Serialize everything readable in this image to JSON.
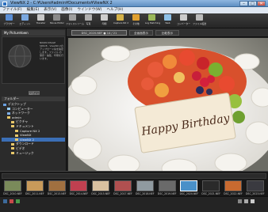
{
  "window": {
    "title": "ViewNX 2 - C:¥Users¥admin¥Documents¥ViewNX 2",
    "min_label": "–",
    "max_label": "□",
    "close_label": "✕"
  },
  "menu": [
    "ファイル(F)",
    "編集(E)",
    "表示(V)",
    "画像(I)",
    "ウインドウ(W)",
    "ヘルプ(H)"
  ],
  "toolbar": [
    {
      "label": "ブラウザー",
      "icon": "browser-icon",
      "color": "#5b8fd6"
    },
    {
      "label": "エディット",
      "icon": "edit-icon",
      "color": "#7aa8e0"
    },
    {
      "label": "Transfer",
      "icon": "transfer-icon",
      "color": "#c9c9c9"
    },
    {
      "label": "Movie Editor",
      "icon": "movie-editor-icon",
      "color": "#8a8a8a"
    },
    {
      "label": "フォトストリーム",
      "icon": "photostream-icon",
      "color": "#9f9f9f"
    },
    {
      "label": "写真",
      "icon": "photo-icon",
      "color": "#b0b0b0"
    },
    {
      "label": "印刷",
      "icon": "print-icon",
      "color": "#cfcfcf"
    },
    {
      "label": "Capture NX 2",
      "icon": "capture-nx-icon",
      "color": "#d4b24a"
    },
    {
      "label": "その他",
      "icon": "other-icon",
      "color": "#e0a030"
    },
    {
      "label": "Log Matching",
      "icon": "log-matching-icon",
      "color": "#9ab85a"
    },
    {
      "label": "Web",
      "icon": "web-icon",
      "color": "#8ec1e8"
    },
    {
      "label": "コンバーター",
      "icon": "converter-icon",
      "color": "#cccccc"
    },
    {
      "label": "ファイル転送",
      "icon": "file-transfer-icon",
      "color": "#bbbbbb"
    }
  ],
  "left_panel": {
    "tab_title": "My Picturetown",
    "info_text": "NIKON IMAGE SPACE、ViewNX 2のアップロード先を指定します。ファイル の保存・編集、印刷を行います。",
    "button_label": "ログイン",
    "tree_title": "フォルダー",
    "tree": [
      {
        "label": "デスクトップ",
        "color": "#6aa0e0",
        "indent": 0,
        "selected": false
      },
      {
        "label": "コンピューター",
        "color": "#9ad0ff",
        "indent": 1,
        "selected": false
      },
      {
        "label": "ネットワーク",
        "color": "#7fb0e8",
        "indent": 1,
        "selected": false
      },
      {
        "label": "admin",
        "color": "#e8c86a",
        "indent": 1,
        "selected": false
      },
      {
        "label": "ピクチャ",
        "color": "#e8c86a",
        "indent": 2,
        "selected": false
      },
      {
        "label": "ドキュメント",
        "color": "#e8c86a",
        "indent": 2,
        "selected": false
      },
      {
        "label": "Capture NX 2",
        "color": "#e8c86a",
        "indent": 3,
        "selected": false
      },
      {
        "label": "ViewNX",
        "color": "#e8c86a",
        "indent": 3,
        "selected": false
      },
      {
        "label": "ViewNX 2",
        "color": "#e8c86a",
        "indent": 3,
        "selected": true
      },
      {
        "label": "ダウンロード",
        "color": "#e8c86a",
        "indent": 2,
        "selected": false
      },
      {
        "label": "ビデオ",
        "color": "#e8c86a",
        "indent": 2,
        "selected": false
      },
      {
        "label": "ミュージック",
        "color": "#e8c86a",
        "indent": 2,
        "selected": false
      }
    ]
  },
  "view_tabs": [
    {
      "label": "DSC_2020.NEF ● 14 / 21",
      "active": true
    },
    {
      "label": "全画面表示",
      "active": false
    },
    {
      "label": "比較表示",
      "active": false
    }
  ],
  "cake": {
    "plaque_text": "Happy Birthday",
    "plaque_color": "#f4ead6",
    "text_color": "#4a2a1a"
  },
  "thumbnails": [
    {
      "caption": "DSC_2010.NEF",
      "color": "#7a8a5a"
    },
    {
      "caption": "DSC_2011.NEF",
      "color": "#c89a5a"
    },
    {
      "caption": "DSC_2013.NEF",
      "color": "#a07040"
    },
    {
      "caption": "DSC_2014.NEF",
      "color": "#c04050"
    },
    {
      "caption": "DSC_2015.NEF",
      "color": "#d8c0a0"
    },
    {
      "caption": "DSC_2017.NEF",
      "color": "#b05050"
    },
    {
      "caption": "DSC_2018.NEF",
      "color": "#909aa0"
    },
    {
      "caption": "DSC_2019.NEF",
      "color": "#6a6a6a"
    },
    {
      "caption": "DSC_2020.NEF",
      "color": "#4a90c8"
    },
    {
      "caption": "DSC_2021.NEF",
      "color": "#2a2a2a"
    },
    {
      "caption": "DSC_2022.NEF",
      "color": "#c86a30"
    },
    {
      "caption": "DSC_2023.NEF",
      "color": "#3a3a40"
    }
  ]
}
